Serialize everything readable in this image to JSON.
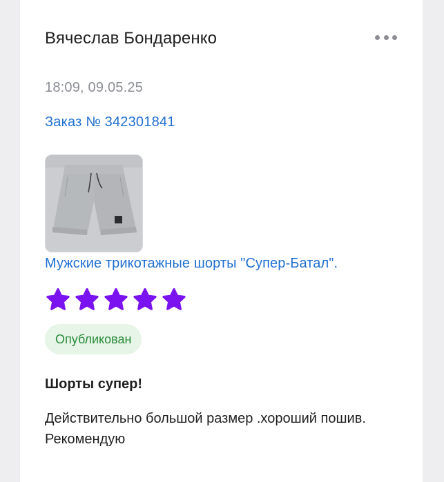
{
  "review": {
    "author": "Вячеслав Бондаренко",
    "datetime": "18:09, 09.05.25",
    "order_link": "Заказ № 342301841",
    "product": {
      "name": "Мужские трикотажные шорты \"Супер-Батал\".",
      "image_icon": "gray-shorts-photo"
    },
    "rating": 5,
    "rating_max": 5,
    "status": "Опубликован",
    "title": "Шорты супер!",
    "text": "Действительно большой размер .хороший пошив. Рекомендую"
  },
  "colors": {
    "background": "#eeeef0",
    "card": "#ffffff",
    "link": "#1f6fd1",
    "star": "#7b12f0",
    "badge_bg": "#e6f5e7",
    "badge_text": "#2a8a3a",
    "muted": "#8a8d93"
  },
  "icons": {
    "menu": "more-dots-icon",
    "rating": "star-icon"
  }
}
